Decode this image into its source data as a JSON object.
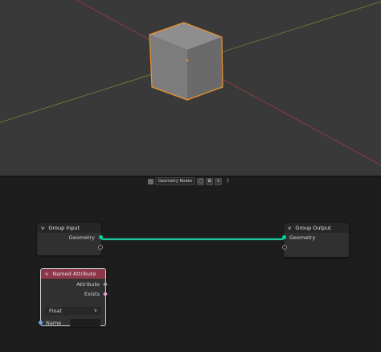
{
  "node_editor": {
    "header": {
      "tree_name": "Geometry Nodes",
      "icon": "node-tree-icon"
    },
    "links": [
      {
        "from": "Group Input.Geometry",
        "to": "Group Output.Geometry",
        "color": "#1fc4a0"
      }
    ]
  },
  "nodes": {
    "group_input": {
      "title": "Group Input",
      "outputs": [
        "Geometry"
      ]
    },
    "group_output": {
      "title": "Group Output",
      "inputs": [
        "Geometry"
      ]
    },
    "named_attribute": {
      "title": "Named Attribute",
      "header_color": "#8e3748",
      "outputs": [
        "Attribute",
        "Exists"
      ],
      "data_type": "Float",
      "name_label": "Name",
      "name_value": ""
    }
  },
  "colors": {
    "viewport_bg": "#393939",
    "editor_bg": "#1d1d1d",
    "geometry_socket": "#00d6a3",
    "selection_outline": "#f0932c"
  }
}
